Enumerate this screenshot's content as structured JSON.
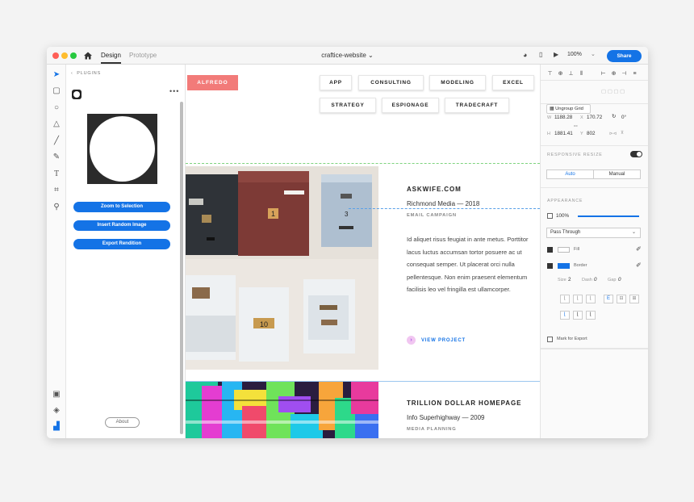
{
  "titlebar": {
    "tab_design": "Design",
    "tab_prototype": "Prototype",
    "document_title": "craftice-website",
    "zoom_level": "100%",
    "share_label": "Share"
  },
  "toolbar": {
    "tools": [
      "select-tool-icon",
      "rectangle-tool-icon",
      "ellipse-tool-icon",
      "polygon-tool-icon",
      "line-tool-icon",
      "pen-tool-icon",
      "text-tool-icon",
      "artboard-tool-icon",
      "zoom-tool-icon"
    ]
  },
  "plugins": {
    "header": "PLUGINS",
    "buttons": [
      "Zoom to Selection",
      "Insert Random Image",
      "Export Rendition"
    ],
    "about_label": "About"
  },
  "canvas": {
    "logo": "ALFREDO",
    "nav_row1": [
      "APP",
      "CONSULTING",
      "MODELING",
      "EXCEL"
    ],
    "nav_row2": [
      "STRATEGY",
      "ESPIONAGE",
      "TRADECRAFT"
    ],
    "project1": {
      "title": "ASKWIFE.COM",
      "client": "Richmond Media — 2018",
      "category": "EMAIL CAMPAIGN",
      "description": "Id aliquet risus feugiat in ante metus. Porttitor lacus luctus accumsan tortor posuere ac ut consequat semper. Ut placerat orci nulla pellentesque. Non enim praesent elementum facilisis leo vel fringilla est ullamcorper.",
      "link": "VIEW PROJECT"
    },
    "project2": {
      "title": "TRILLION DOLLAR HOMEPAGE",
      "client": "Info Superhighway — 2009",
      "category": "MEDIA PLANNING"
    }
  },
  "inspector": {
    "ungroup_label": "Ungroup Grid",
    "w_label": "W",
    "w_value": "1188.28",
    "x_label": "X",
    "x_value": "170.72",
    "rotation": "0°",
    "h_label": "H",
    "h_value": "1881.41",
    "y_label": "Y",
    "y_value": "802",
    "responsive_label": "RESPONSIVE RESIZE",
    "auto_label": "Auto",
    "manual_label": "Manual",
    "appearance_label": "APPEARANCE",
    "opacity": "100%",
    "blend_mode": "Pass Through",
    "fill_label": "Fill",
    "border_label": "Border",
    "size_label": "Size",
    "size_value": "2",
    "dash_label": "Dash",
    "dash_value": "0",
    "gap_label": "Gap",
    "gap_value": "0",
    "export_label": "Mark for Export",
    "border_color": "#1473e6",
    "accent": "#1473e6"
  }
}
